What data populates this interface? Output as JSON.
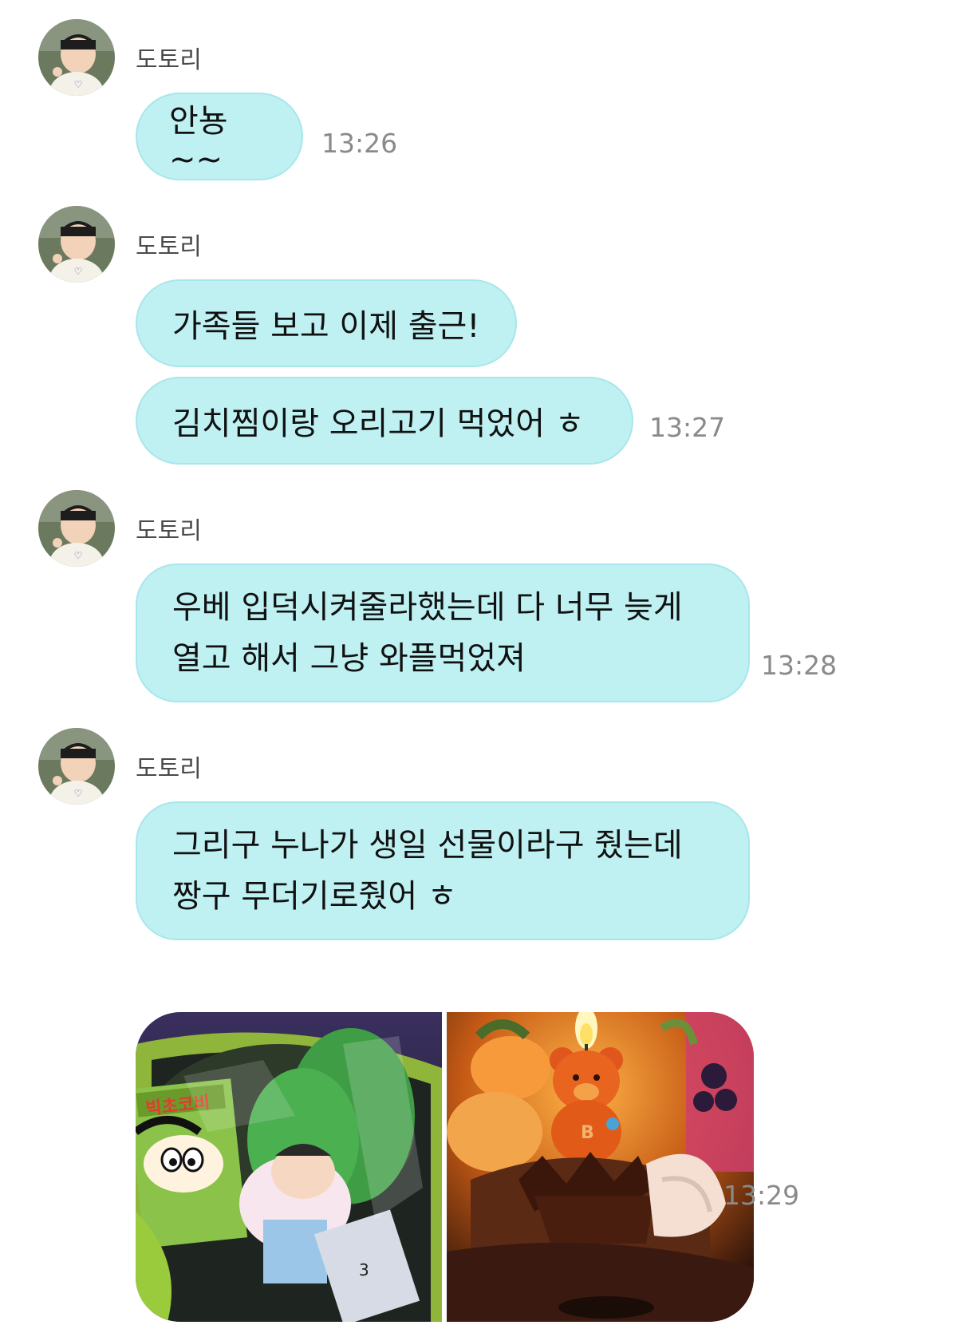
{
  "chat": {
    "groups": [
      {
        "sender": "도토리",
        "messages": [
          {
            "text": "안뇽~~",
            "time": "13:26"
          }
        ]
      },
      {
        "sender": "도토리",
        "messages": [
          {
            "text": "가족들 보고 이제 출근!",
            "time": ""
          },
          {
            "text": "김치찜이랑 오리고기 먹었어 ㅎ",
            "time": "13:27"
          }
        ]
      },
      {
        "sender": "도토리",
        "messages": [
          {
            "text": "우베 입덕시켜줄라했는데 다 너무 늦게\n열고 해서 그냥 와플먹었져",
            "time": "13:28"
          }
        ]
      },
      {
        "sender": "도토리",
        "messages": [
          {
            "text": "그리구 누나가 생일 선물이라구 줬는데\n짱구 무더기로줬어 ㅎ",
            "time": ""
          }
        ],
        "photos": {
          "time": "13:29",
          "snack_box_label": "빅초코비"
        }
      }
    ]
  },
  "colors": {
    "bubble": "#bff1f3",
    "bubble_border": "#a8e6ea",
    "sender_text": "#4a4a4a",
    "time_text": "#8a8a8a"
  }
}
